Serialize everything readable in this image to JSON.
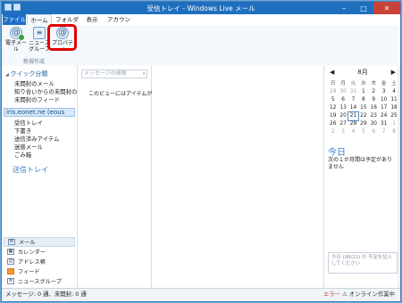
{
  "window": {
    "title": "受信トレイ - Windows Live メール"
  },
  "tabs": [
    "ファイル",
    "ホーム",
    "フォルダー",
    "表示",
    "アカウント"
  ],
  "ribbon": {
    "mail_label": "電子メール",
    "news_label": "ニュース グループ",
    "prop_label": "プロパティ",
    "group_label": "新規作成"
  },
  "sidebar": {
    "quick_title": "クイック分類",
    "quick_items": [
      "未開封のメール",
      "知り合いからの未開封の...",
      "未開封のフィード"
    ],
    "account": "iris.eonet.ne (eous",
    "folders": [
      "受信トレイ",
      "下書き",
      "送信済みアイテム",
      "迷惑メール",
      "ごみ箱"
    ],
    "inbox_big": "送信トレイ",
    "nav": [
      "メール",
      "カレンダー",
      "アドレス帳",
      "フィード",
      "ニュースグループ"
    ]
  },
  "messages": {
    "search_placeholder": "メッセージの検索",
    "empty_text": "このビューにはアイテムがありません。"
  },
  "calendar": {
    "month": "8月",
    "dow": [
      "日",
      "月",
      "火",
      "水",
      "木",
      "金",
      "土"
    ],
    "weeks": [
      [
        "29",
        "30",
        "31",
        "1",
        "2",
        "3",
        "4"
      ],
      [
        "5",
        "6",
        "7",
        "8",
        "9",
        "10",
        "11"
      ],
      [
        "12",
        "13",
        "14",
        "15",
        "16",
        "17",
        "18"
      ],
      [
        "19",
        "20",
        "21",
        "22",
        "23",
        "24",
        "25"
      ],
      [
        "26",
        "27",
        "28",
        "29",
        "30",
        "31",
        "1"
      ],
      [
        "2",
        "3",
        "4",
        "5",
        "6",
        "7",
        "8"
      ]
    ],
    "today_label": "今日",
    "today_note": "次の１か月間は予定がありません",
    "note_box": "今日 (08/21) の 予定を記入してください"
  },
  "status": {
    "left": "メッセージ: 0 通、未開封: 0 通",
    "error": "エラー",
    "online": "オンライン作業中"
  }
}
